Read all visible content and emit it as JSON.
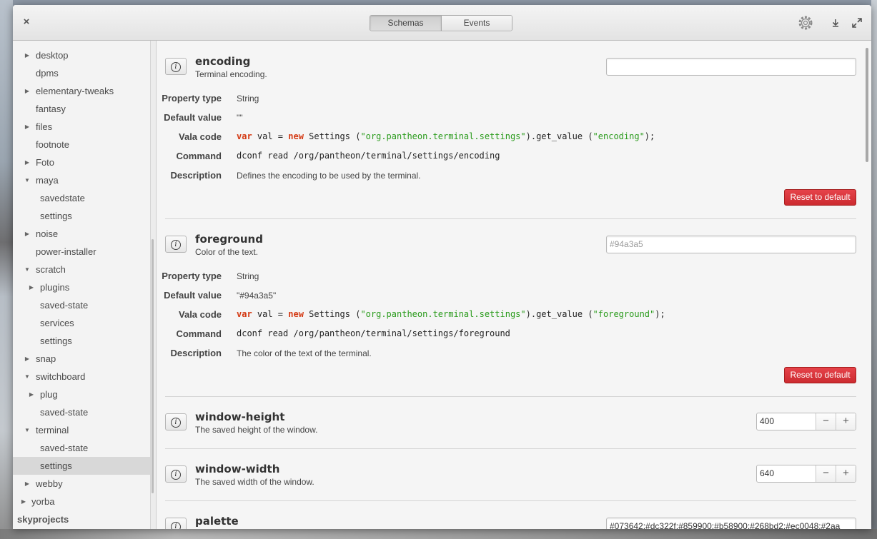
{
  "titlebar": {
    "close_label": "×",
    "tabs": [
      {
        "label": "Schemas",
        "active": true
      },
      {
        "label": "Events",
        "active": false
      }
    ],
    "icons": [
      "gear-icon",
      "download-icon",
      "fullscreen-icon"
    ]
  },
  "sidebar": {
    "items": [
      {
        "label": "desktop",
        "arrow": "▶",
        "depth": 0,
        "expandable": true
      },
      {
        "label": "dpms",
        "arrow": "",
        "depth": 0,
        "expandable": false
      },
      {
        "label": "elementary-tweaks",
        "arrow": "▶",
        "depth": 0,
        "expandable": true
      },
      {
        "label": "fantasy",
        "arrow": "",
        "depth": 0,
        "expandable": false
      },
      {
        "label": "files",
        "arrow": "▶",
        "depth": 0,
        "expandable": true
      },
      {
        "label": "footnote",
        "arrow": "",
        "depth": 0,
        "expandable": false
      },
      {
        "label": "Foto",
        "arrow": "▶",
        "depth": 0,
        "expandable": true
      },
      {
        "label": "maya",
        "arrow": "▼",
        "depth": 0,
        "expandable": true
      },
      {
        "label": "savedstate",
        "arrow": "",
        "depth": 1,
        "expandable": false
      },
      {
        "label": "settings",
        "arrow": "",
        "depth": 1,
        "expandable": false
      },
      {
        "label": "noise",
        "arrow": "▶",
        "depth": 0,
        "expandable": true
      },
      {
        "label": "power-installer",
        "arrow": "",
        "depth": 0,
        "expandable": false
      },
      {
        "label": "scratch",
        "arrow": "▼",
        "depth": 0,
        "expandable": true
      },
      {
        "label": "plugins",
        "arrow": "▶",
        "depth": 1,
        "expandable": true
      },
      {
        "label": "saved-state",
        "arrow": "",
        "depth": 1,
        "expandable": false
      },
      {
        "label": "services",
        "arrow": "",
        "depth": 1,
        "expandable": false
      },
      {
        "label": "settings",
        "arrow": "",
        "depth": 1,
        "expandable": false
      },
      {
        "label": "snap",
        "arrow": "▶",
        "depth": 0,
        "expandable": true
      },
      {
        "label": "switchboard",
        "arrow": "▼",
        "depth": 0,
        "expandable": true
      },
      {
        "label": "plug",
        "arrow": "▶",
        "depth": 1,
        "expandable": true
      },
      {
        "label": "saved-state",
        "arrow": "",
        "depth": 1,
        "expandable": false
      },
      {
        "label": "terminal",
        "arrow": "▼",
        "depth": 0,
        "expandable": true
      },
      {
        "label": "saved-state",
        "arrow": "",
        "depth": 1,
        "expandable": false
      },
      {
        "label": "settings",
        "arrow": "",
        "depth": 1,
        "expandable": false,
        "selected": true
      },
      {
        "label": "webby",
        "arrow": "▶",
        "depth": 0,
        "expandable": true
      },
      {
        "label": "yorba",
        "arrow": "▶",
        "depth": -1,
        "expandable": true
      },
      {
        "label": "skyprojects",
        "arrow": "",
        "depth": -2,
        "expandable": false,
        "header": true
      }
    ]
  },
  "labels": {
    "property_type": "Property type",
    "default_value": "Default value",
    "vala_code": "Vala code",
    "command": "Command",
    "description": "Description",
    "reset": "Reset to default"
  },
  "keys": {
    "encoding": {
      "name": "encoding",
      "summary": "Terminal encoding.",
      "value": "",
      "placeholder": "",
      "type": "String",
      "default": "\"\"",
      "vala_kw1": "var",
      "vala_mid": " val = ",
      "vala_kw2": "new",
      "vala_call": " Settings (",
      "vala_schema": "\"org.pantheon.terminal.settings\"",
      "vala_get": ").get_value (",
      "vala_key": "\"encoding\"",
      "vala_end": ");",
      "command": "dconf read /org/pantheon/terminal/settings/encoding",
      "description": "Defines the encoding to be used by the terminal."
    },
    "foreground": {
      "name": "foreground",
      "summary": "Color of the text.",
      "value": "",
      "placeholder": "#94a3a5",
      "type": "String",
      "default": "\"#94a3a5\"",
      "vala_kw1": "var",
      "vala_mid": " val = ",
      "vala_kw2": "new",
      "vala_call": " Settings (",
      "vala_schema": "\"org.pantheon.terminal.settings\"",
      "vala_get": ").get_value (",
      "vala_key": "\"foreground\"",
      "vala_end": ");",
      "command": "dconf read /org/pantheon/terminal/settings/foreground",
      "description": "The color of the text of the terminal."
    },
    "window_height": {
      "name": "window-height",
      "summary": "The saved height of the window.",
      "value": "400",
      "minus": "−",
      "plus": "+"
    },
    "window_width": {
      "name": "window-width",
      "summary": "The saved width of the window.",
      "value": "640",
      "minus": "−",
      "plus": "+"
    },
    "palette": {
      "name": "palette",
      "value": "#073642:#dc322f:#859900:#b58900:#268bd2:#ec0048:#2aa"
    }
  },
  "colors": {
    "accent_reset": "#d6353a",
    "keyword": "#d43a14",
    "string": "#2a9b1c"
  }
}
